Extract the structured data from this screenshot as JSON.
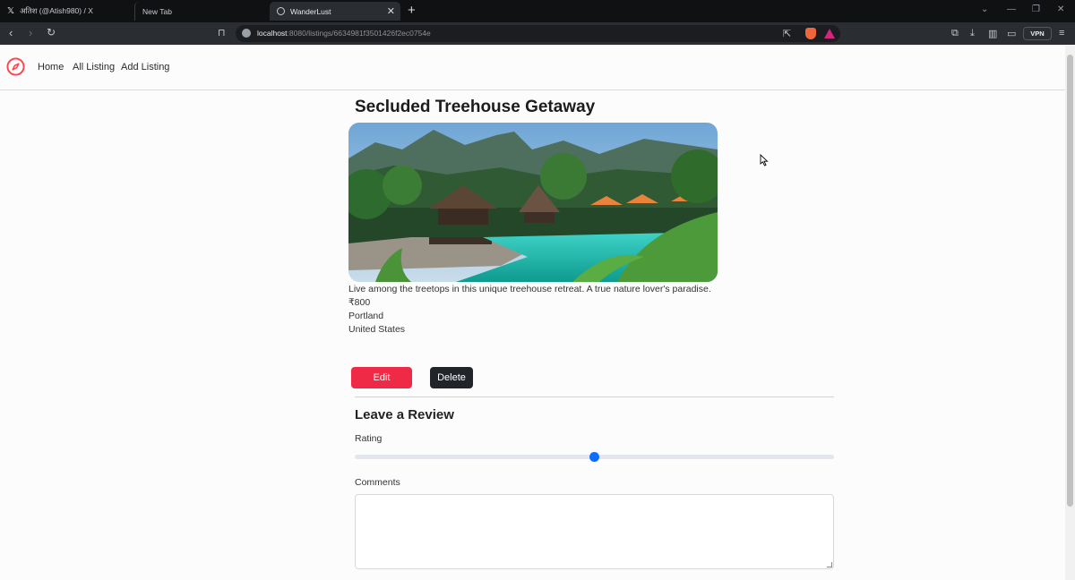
{
  "browser": {
    "tabs": [
      {
        "label": "अतिश (@Atish980) / X",
        "icon": "x-logo-icon"
      },
      {
        "label": "New Tab",
        "icon": ""
      },
      {
        "label": "WanderLust",
        "icon": "globe-icon",
        "active": true
      }
    ],
    "url_host": "localhost",
    "url_rest": ":8080/listings/6634981f3501426f2ec0754e",
    "vpn_label": "VPN"
  },
  "navbar": {
    "links": [
      {
        "label": "Home"
      },
      {
        "label": "All Listing"
      },
      {
        "label": "Add Listing"
      }
    ],
    "brand_color": "#fe424d"
  },
  "listing": {
    "title": "Secluded Treehouse Getaway",
    "description": "Live among the treetops in this unique treehouse retreat. A true nature lover's paradise.",
    "price": "₹800",
    "city": "Portland",
    "country": "United States"
  },
  "actions": {
    "edit_label": "Edit",
    "delete_label": "Delete",
    "edit_color": "#ee2a47",
    "delete_color": "#212529"
  },
  "review": {
    "heading": "Leave a Review",
    "rating_label": "Rating",
    "rating_value": 3,
    "rating_min": 1,
    "rating_max": 5,
    "comments_label": "Comments",
    "comments_value": ""
  }
}
